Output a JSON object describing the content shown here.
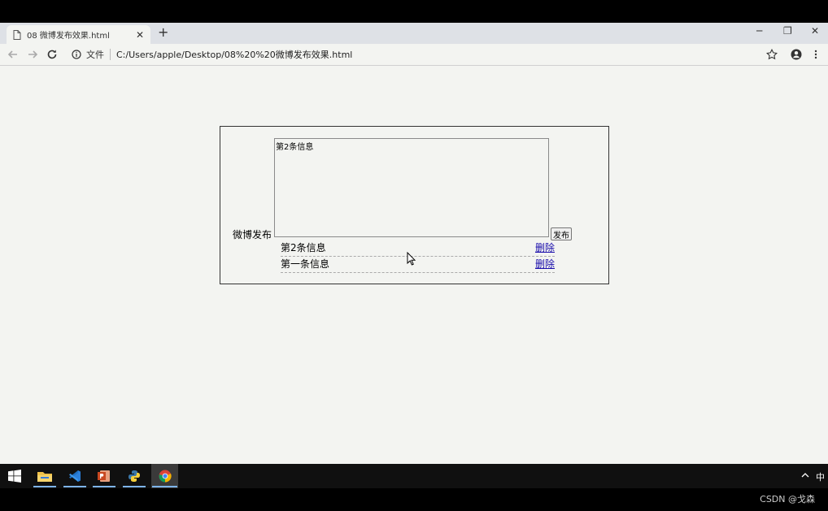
{
  "browser": {
    "tab_title": "08  微博发布效果.html",
    "protocol_label": "文件",
    "url": "C:/Users/apple/Desktop/08%20%20微博发布效果.html"
  },
  "page": {
    "label": "微博发布",
    "textarea_value": "第2条信息",
    "publish_button": "发布",
    "posts": [
      {
        "text": "第2条信息",
        "delete": "删除"
      },
      {
        "text": "第一条信息",
        "delete": "删除"
      }
    ]
  },
  "taskbar": {
    "apps": [
      "file-explorer",
      "vscode",
      "powerpoint",
      "python",
      "chrome"
    ],
    "tray_ime": "中"
  },
  "watermark": "CSDN @戈森",
  "colors": {
    "link": "#1a0dab",
    "page_bg": "#f3f4f1",
    "taskbar_bg": "#101010"
  }
}
